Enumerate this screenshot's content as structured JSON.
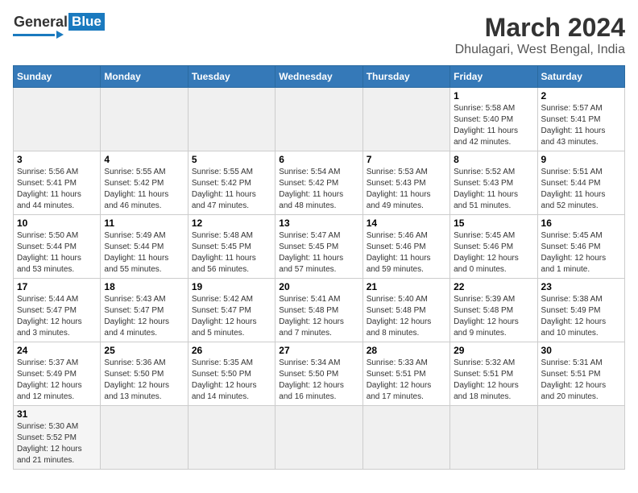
{
  "header": {
    "month_year": "March 2024",
    "location": "Dhulagari, West Bengal, India",
    "logo_general": "General",
    "logo_blue": "Blue"
  },
  "days_of_week": [
    "Sunday",
    "Monday",
    "Tuesday",
    "Wednesday",
    "Thursday",
    "Friday",
    "Saturday"
  ],
  "weeks": [
    [
      {
        "day": "",
        "info": "",
        "empty": true
      },
      {
        "day": "",
        "info": "",
        "empty": true
      },
      {
        "day": "",
        "info": "",
        "empty": true
      },
      {
        "day": "",
        "info": "",
        "empty": true
      },
      {
        "day": "",
        "info": "",
        "empty": true
      },
      {
        "day": "1",
        "info": "Sunrise: 5:58 AM\nSunset: 5:40 PM\nDaylight: 11 hours\nand 42 minutes."
      },
      {
        "day": "2",
        "info": "Sunrise: 5:57 AM\nSunset: 5:41 PM\nDaylight: 11 hours\nand 43 minutes."
      }
    ],
    [
      {
        "day": "3",
        "info": "Sunrise: 5:56 AM\nSunset: 5:41 PM\nDaylight: 11 hours\nand 44 minutes."
      },
      {
        "day": "4",
        "info": "Sunrise: 5:55 AM\nSunset: 5:42 PM\nDaylight: 11 hours\nand 46 minutes."
      },
      {
        "day": "5",
        "info": "Sunrise: 5:55 AM\nSunset: 5:42 PM\nDaylight: 11 hours\nand 47 minutes."
      },
      {
        "day": "6",
        "info": "Sunrise: 5:54 AM\nSunset: 5:42 PM\nDaylight: 11 hours\nand 48 minutes."
      },
      {
        "day": "7",
        "info": "Sunrise: 5:53 AM\nSunset: 5:43 PM\nDaylight: 11 hours\nand 49 minutes."
      },
      {
        "day": "8",
        "info": "Sunrise: 5:52 AM\nSunset: 5:43 PM\nDaylight: 11 hours\nand 51 minutes."
      },
      {
        "day": "9",
        "info": "Sunrise: 5:51 AM\nSunset: 5:44 PM\nDaylight: 11 hours\nand 52 minutes."
      }
    ],
    [
      {
        "day": "10",
        "info": "Sunrise: 5:50 AM\nSunset: 5:44 PM\nDaylight: 11 hours\nand 53 minutes."
      },
      {
        "day": "11",
        "info": "Sunrise: 5:49 AM\nSunset: 5:44 PM\nDaylight: 11 hours\nand 55 minutes."
      },
      {
        "day": "12",
        "info": "Sunrise: 5:48 AM\nSunset: 5:45 PM\nDaylight: 11 hours\nand 56 minutes."
      },
      {
        "day": "13",
        "info": "Sunrise: 5:47 AM\nSunset: 5:45 PM\nDaylight: 11 hours\nand 57 minutes."
      },
      {
        "day": "14",
        "info": "Sunrise: 5:46 AM\nSunset: 5:46 PM\nDaylight: 11 hours\nand 59 minutes."
      },
      {
        "day": "15",
        "info": "Sunrise: 5:45 AM\nSunset: 5:46 PM\nDaylight: 12 hours\nand 0 minutes."
      },
      {
        "day": "16",
        "info": "Sunrise: 5:45 AM\nSunset: 5:46 PM\nDaylight: 12 hours\nand 1 minute."
      }
    ],
    [
      {
        "day": "17",
        "info": "Sunrise: 5:44 AM\nSunset: 5:47 PM\nDaylight: 12 hours\nand 3 minutes."
      },
      {
        "day": "18",
        "info": "Sunrise: 5:43 AM\nSunset: 5:47 PM\nDaylight: 12 hours\nand 4 minutes."
      },
      {
        "day": "19",
        "info": "Sunrise: 5:42 AM\nSunset: 5:47 PM\nDaylight: 12 hours\nand 5 minutes."
      },
      {
        "day": "20",
        "info": "Sunrise: 5:41 AM\nSunset: 5:48 PM\nDaylight: 12 hours\nand 7 minutes."
      },
      {
        "day": "21",
        "info": "Sunrise: 5:40 AM\nSunset: 5:48 PM\nDaylight: 12 hours\nand 8 minutes."
      },
      {
        "day": "22",
        "info": "Sunrise: 5:39 AM\nSunset: 5:48 PM\nDaylight: 12 hours\nand 9 minutes."
      },
      {
        "day": "23",
        "info": "Sunrise: 5:38 AM\nSunset: 5:49 PM\nDaylight: 12 hours\nand 10 minutes."
      }
    ],
    [
      {
        "day": "24",
        "info": "Sunrise: 5:37 AM\nSunset: 5:49 PM\nDaylight: 12 hours\nand 12 minutes."
      },
      {
        "day": "25",
        "info": "Sunrise: 5:36 AM\nSunset: 5:50 PM\nDaylight: 12 hours\nand 13 minutes."
      },
      {
        "day": "26",
        "info": "Sunrise: 5:35 AM\nSunset: 5:50 PM\nDaylight: 12 hours\nand 14 minutes."
      },
      {
        "day": "27",
        "info": "Sunrise: 5:34 AM\nSunset: 5:50 PM\nDaylight: 12 hours\nand 16 minutes."
      },
      {
        "day": "28",
        "info": "Sunrise: 5:33 AM\nSunset: 5:51 PM\nDaylight: 12 hours\nand 17 minutes."
      },
      {
        "day": "29",
        "info": "Sunrise: 5:32 AM\nSunset: 5:51 PM\nDaylight: 12 hours\nand 18 minutes."
      },
      {
        "day": "30",
        "info": "Sunrise: 5:31 AM\nSunset: 5:51 PM\nDaylight: 12 hours\nand 20 minutes."
      }
    ],
    [
      {
        "day": "31",
        "info": "Sunrise: 5:30 AM\nSunset: 5:52 PM\nDaylight: 12 hours\nand 21 minutes.",
        "last": true
      },
      {
        "day": "",
        "info": "",
        "empty": true
      },
      {
        "day": "",
        "info": "",
        "empty": true
      },
      {
        "day": "",
        "info": "",
        "empty": true
      },
      {
        "day": "",
        "info": "",
        "empty": true
      },
      {
        "day": "",
        "info": "",
        "empty": true
      },
      {
        "day": "",
        "info": "",
        "empty": true
      }
    ]
  ]
}
